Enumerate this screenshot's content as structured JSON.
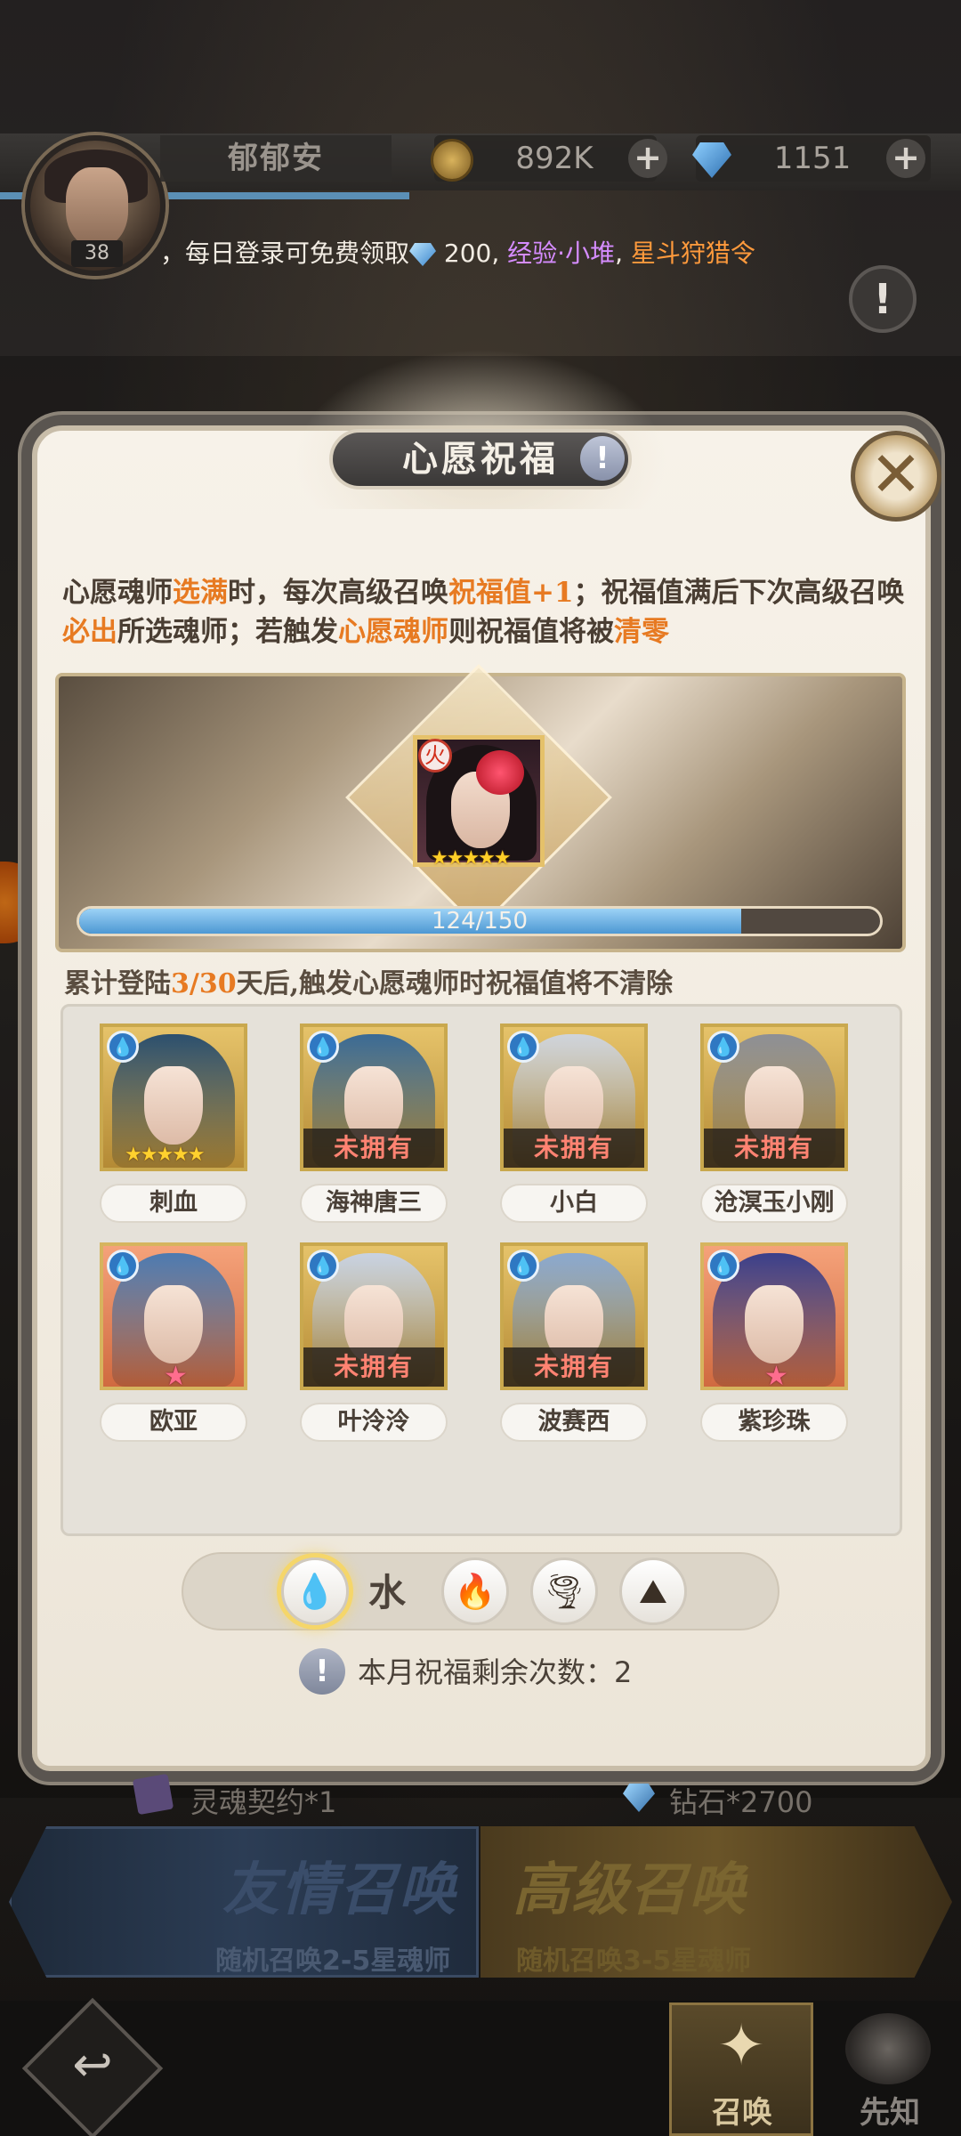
{
  "header": {
    "player_name": "郁郁安",
    "level": "38",
    "coins": "892K",
    "diamonds": "1151",
    "plus": "+",
    "ticker": {
      "prefix": "，每日登录可免费领取",
      "diamond_amount": " 200, ",
      "exp": "经验·小堆",
      "comma": ", ",
      "pass": "星斗狩猎令"
    },
    "info": "!"
  },
  "modal": {
    "title": "心愿祝福",
    "title_info": "!",
    "close": "✕",
    "desc": {
      "p1": "心愿魂师",
      "h1": "选满",
      "p2": "时，每次高级召唤",
      "h2": "祝福值+1",
      "p3": "；祝福值满后下次高级召唤",
      "h3": "必出",
      "p4": "所选魂师；若触发",
      "h4": "心愿魂师",
      "p5": "则祝福值将被",
      "h5": "清零"
    },
    "selected": {
      "element": "火",
      "stars": "★★★★★"
    },
    "progress": {
      "current": 124,
      "max": 150,
      "label": "124/150"
    },
    "login_note": {
      "p1": "累计登陆",
      "h1": "3/30",
      "p2": "天后,触发心愿魂师时祝福值将不清除"
    },
    "unowned_label": "未拥有",
    "heroes": [
      {
        "name": "刺血",
        "stars": "★★★★★",
        "owned": true,
        "frame": "gold"
      },
      {
        "name": "海神唐三",
        "owned": false,
        "frame": "gold"
      },
      {
        "name": "小白",
        "owned": false,
        "frame": "gold"
      },
      {
        "name": "沧溟玉小刚",
        "owned": false,
        "frame": "gold"
      },
      {
        "name": "欧亚",
        "star": "★",
        "owned": true,
        "frame": "orange"
      },
      {
        "name": "叶泠泠",
        "owned": false,
        "frame": "gold"
      },
      {
        "name": "波赛西",
        "owned": false,
        "frame": "gold"
      },
      {
        "name": "紫珍珠",
        "star": "★",
        "owned": true,
        "frame": "orange"
      }
    ],
    "element_filter": {
      "active_label": "水",
      "water": "💧",
      "fire": "🔥",
      "wind": "🌪",
      "earth": "⛰"
    },
    "remaining": {
      "icon": "!",
      "text": "本月祝福剩余次数：2"
    }
  },
  "bottom": {
    "reward_left": "灵魂契约*1",
    "reward_right": "钻石*2700",
    "friend_summon": {
      "title": "友情召唤",
      "sub": "随机召唤2-5星魂师"
    },
    "advanced_summon": {
      "title": "高级召唤",
      "sub": "随机召唤3-5星魂师"
    },
    "nav": {
      "back": "↩",
      "summon": "召唤",
      "summon_icon": "✦",
      "foresee": "先知"
    }
  }
}
